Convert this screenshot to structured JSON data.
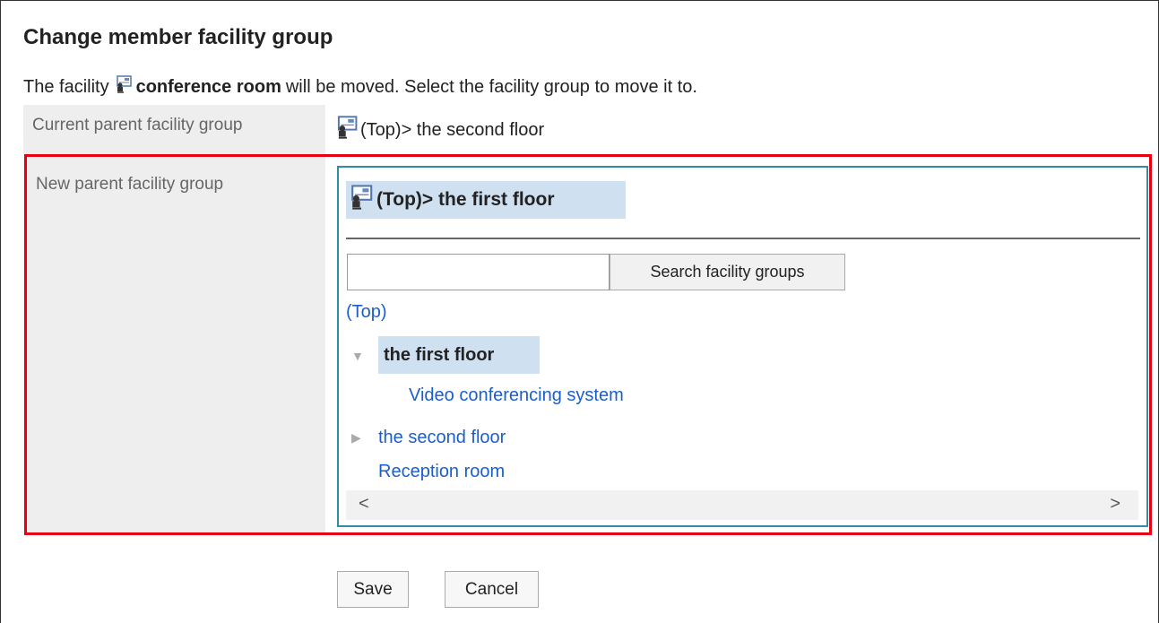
{
  "page": {
    "title": "Change member facility group",
    "description_prefix": "The facility",
    "facility_name": "conference room",
    "description_suffix": "will be moved. Select the facility group to move it to."
  },
  "current_parent": {
    "label": "Current parent facility group",
    "value": "(Top)> the second floor"
  },
  "new_parent": {
    "label": "New parent facility group",
    "selected_value": "(Top)> the first floor",
    "search": {
      "placeholder": "",
      "value": "",
      "button_label": "Search facility groups"
    },
    "tree": {
      "top_label": "(Top)",
      "current_item": "the first floor",
      "child_item": "Video conferencing system",
      "second_item": "the second floor",
      "reception_item": "Reception room",
      "arrow_expanded": "▼",
      "arrow_collapsed": "▶"
    },
    "scrollbar": {
      "left_arrow": "<",
      "right_arrow": ">"
    }
  },
  "actions": {
    "save_label": "Save",
    "cancel_label": "Cancel"
  },
  "colors": {
    "highlight_border": "#e60012",
    "selector_border": "#2d8fa0",
    "selection_bg": "#cfe0f1",
    "link": "#1a5fc9",
    "label_bg": "#eeeeee"
  },
  "icons": {
    "facility": "facility-icon"
  }
}
